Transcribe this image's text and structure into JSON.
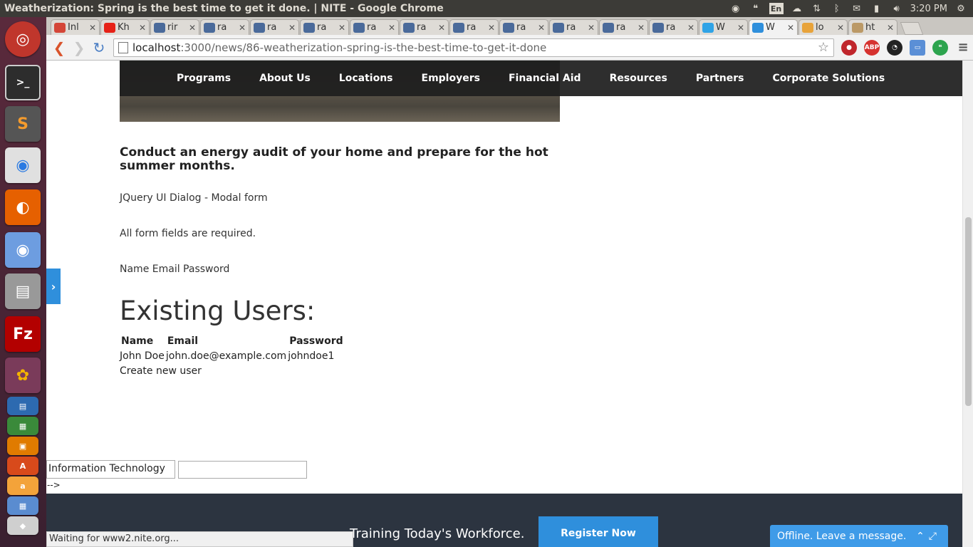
{
  "window": {
    "title": "Weatherization: Spring is the best time to get it done. | NITE - Google Chrome",
    "clock": "3:20 PM",
    "lang": "En"
  },
  "tabs": [
    {
      "label": "Inl",
      "color": "#d44638"
    },
    {
      "label": "Kh",
      "color": "#e62117"
    },
    {
      "label": "rir",
      "color": "#4a6a9a"
    },
    {
      "label": "ra",
      "color": "#4a6a9a"
    },
    {
      "label": "ra",
      "color": "#4a6a9a"
    },
    {
      "label": "ra",
      "color": "#4a6a9a"
    },
    {
      "label": "ra",
      "color": "#4a6a9a"
    },
    {
      "label": "ra",
      "color": "#4a6a9a"
    },
    {
      "label": "ra",
      "color": "#4a6a9a"
    },
    {
      "label": "ra",
      "color": "#4a6a9a"
    },
    {
      "label": "ra",
      "color": "#4a6a9a"
    },
    {
      "label": "ra",
      "color": "#4a6a9a"
    },
    {
      "label": "ra",
      "color": "#4a6a9a"
    },
    {
      "label": "W",
      "color": "#2fa3e6"
    },
    {
      "label": "W",
      "color": "#2f8fdc"
    },
    {
      "label": "lo",
      "color": "#e8a33a"
    },
    {
      "label": "ht",
      "color": "#bb9966"
    }
  ],
  "address": {
    "host": "localhost",
    "path": ":3000/news/86-weatherization-spring-is-the-best-time-to-get-it-done"
  },
  "nav": {
    "items": [
      "Programs",
      "About Us",
      "Locations",
      "Employers",
      "Financial Aid",
      "Resources",
      "Partners",
      "Corporate Solutions"
    ]
  },
  "content": {
    "subtitle": "Conduct an energy audit of your home and prepare for the hot summer months.",
    "dialog_title": "JQuery UI Dialog - Modal form",
    "required_note": "All form fields are required.",
    "form_labels": "Name Email Password",
    "users_heading": "Existing Users:",
    "table_headers": [
      "Name",
      "Email",
      "Password"
    ],
    "rows": [
      [
        "John Doe",
        "john.doe@example.com",
        "johndoe1"
      ]
    ],
    "create_user": "Create new user",
    "select_value": "Information Technology",
    "comment_artifact": "-->"
  },
  "footer": {
    "tagline": "Training Today's Workforce.",
    "register": "Register Now"
  },
  "status": {
    "loading": "Waiting for www2.nite.org..."
  },
  "chat": {
    "label": "Offline. Leave a message."
  },
  "colors": {
    "accent": "#2f8fdc",
    "footer_bg": "#2c3440",
    "nav_bg": "#1e1e1e"
  }
}
